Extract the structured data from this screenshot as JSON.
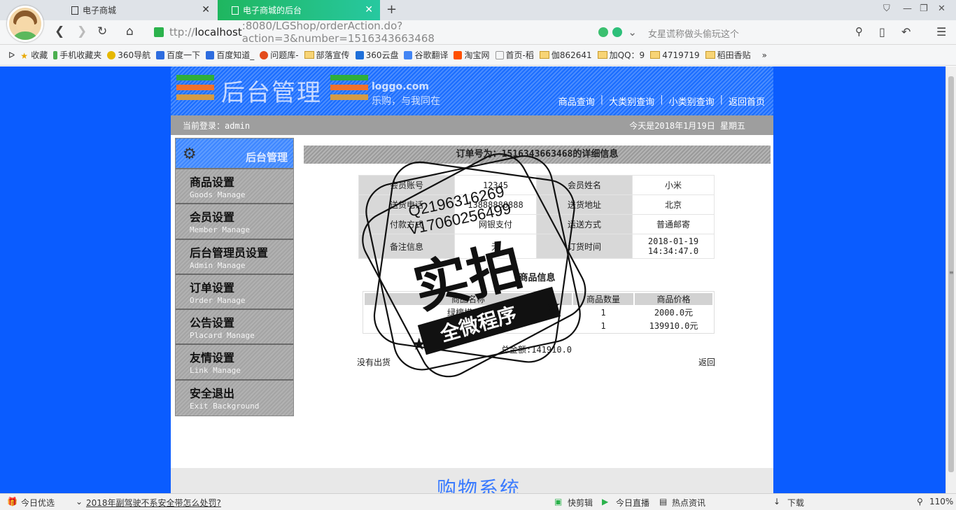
{
  "browser": {
    "tabs": [
      {
        "label": "电子商城"
      },
      {
        "label": "电子商城的后台"
      }
    ],
    "url": {
      "prefix": "ttp://",
      "host": "localhost",
      "rest": ":8080/LGShop/orderAction.do?action=3&number=1516343663468"
    },
    "search_placeholder": "女星谎称做头偷玩这个",
    "bookmarks": [
      "收藏",
      "手机收藏夹",
      "360导航",
      "百度一下",
      "百度知道_",
      "问题库-",
      "部落宣传",
      "360云盘",
      "谷歌翻译",
      "淘宝网",
      "首页-稻",
      "伽862641",
      "加QQ：9",
      "4719719",
      "稻田香贴"
    ],
    "colors": {
      "accent": "#1fb65f",
      "page_bg": "#0a5cff"
    }
  },
  "header": {
    "title": "后台管理",
    "sub1": "loggo.com",
    "sub2": "乐购，与我同在",
    "nav": [
      "商品查询",
      "大类别查询",
      "小类别查询",
      "返回首页"
    ],
    "nav_sep": "|"
  },
  "infobar": {
    "login": "当前登录：admin",
    "date": "今天是2018年1月19日 星期五"
  },
  "sidebar": {
    "title": "后台管理",
    "items": [
      {
        "cn": "商品设置",
        "en": "Goods Manage"
      },
      {
        "cn": "会员设置",
        "en": "Member Manage"
      },
      {
        "cn": "后台管理员设置",
        "en": "Admin Manage"
      },
      {
        "cn": "订单设置",
        "en": "Order Manage"
      },
      {
        "cn": "公告设置",
        "en": "Placard Manage"
      },
      {
        "cn": "友情设置",
        "en": "Link Manage"
      },
      {
        "cn": "安全退出",
        "en": "Exit Background"
      }
    ]
  },
  "order": {
    "title": "订单号为：1516343663468的详细信息",
    "rows": [
      {
        "l1": "会员账号",
        "v1": "12345",
        "l2": "会员姓名",
        "v2": "小米"
      },
      {
        "l1": "送货电话",
        "v1": "13888888888",
        "l2": "送货地址",
        "v2": "北京"
      },
      {
        "l1": "付款方式",
        "v1": "网银支付",
        "l2": "运送方式",
        "v2": "普通邮寄"
      },
      {
        "l1": "备注信息",
        "v1": "无",
        "l2": "订货时间",
        "v2": "2018-01-19 14:34:47.0"
      }
    ],
    "goods_title": "商品信息",
    "goods_headers": [
      "商品名称",
      "商品数量",
      "商品价格"
    ],
    "goods": [
      {
        "name": "绿檀横刀兰",
        "qty": "1",
        "price": "2000.0元"
      },
      {
        "name": "杰士 klips",
        "qty": "1",
        "price": "139910.0元"
      }
    ],
    "total": "总金额:141910.0",
    "status": "没有出货",
    "back": "返回"
  },
  "footer": {
    "title": "购物系统"
  },
  "watermark": {
    "big": "实拍",
    "small": "全微程序",
    "qq": "Q2196316269",
    "v": "V17060256499"
  },
  "statusbar": {
    "left": "今日优选",
    "news": "2018年副驾驶不系安全带怎么处罚?",
    "items": [
      "快剪辑",
      "今日直播",
      "热点资讯",
      "下载"
    ],
    "zoom": "110%"
  }
}
